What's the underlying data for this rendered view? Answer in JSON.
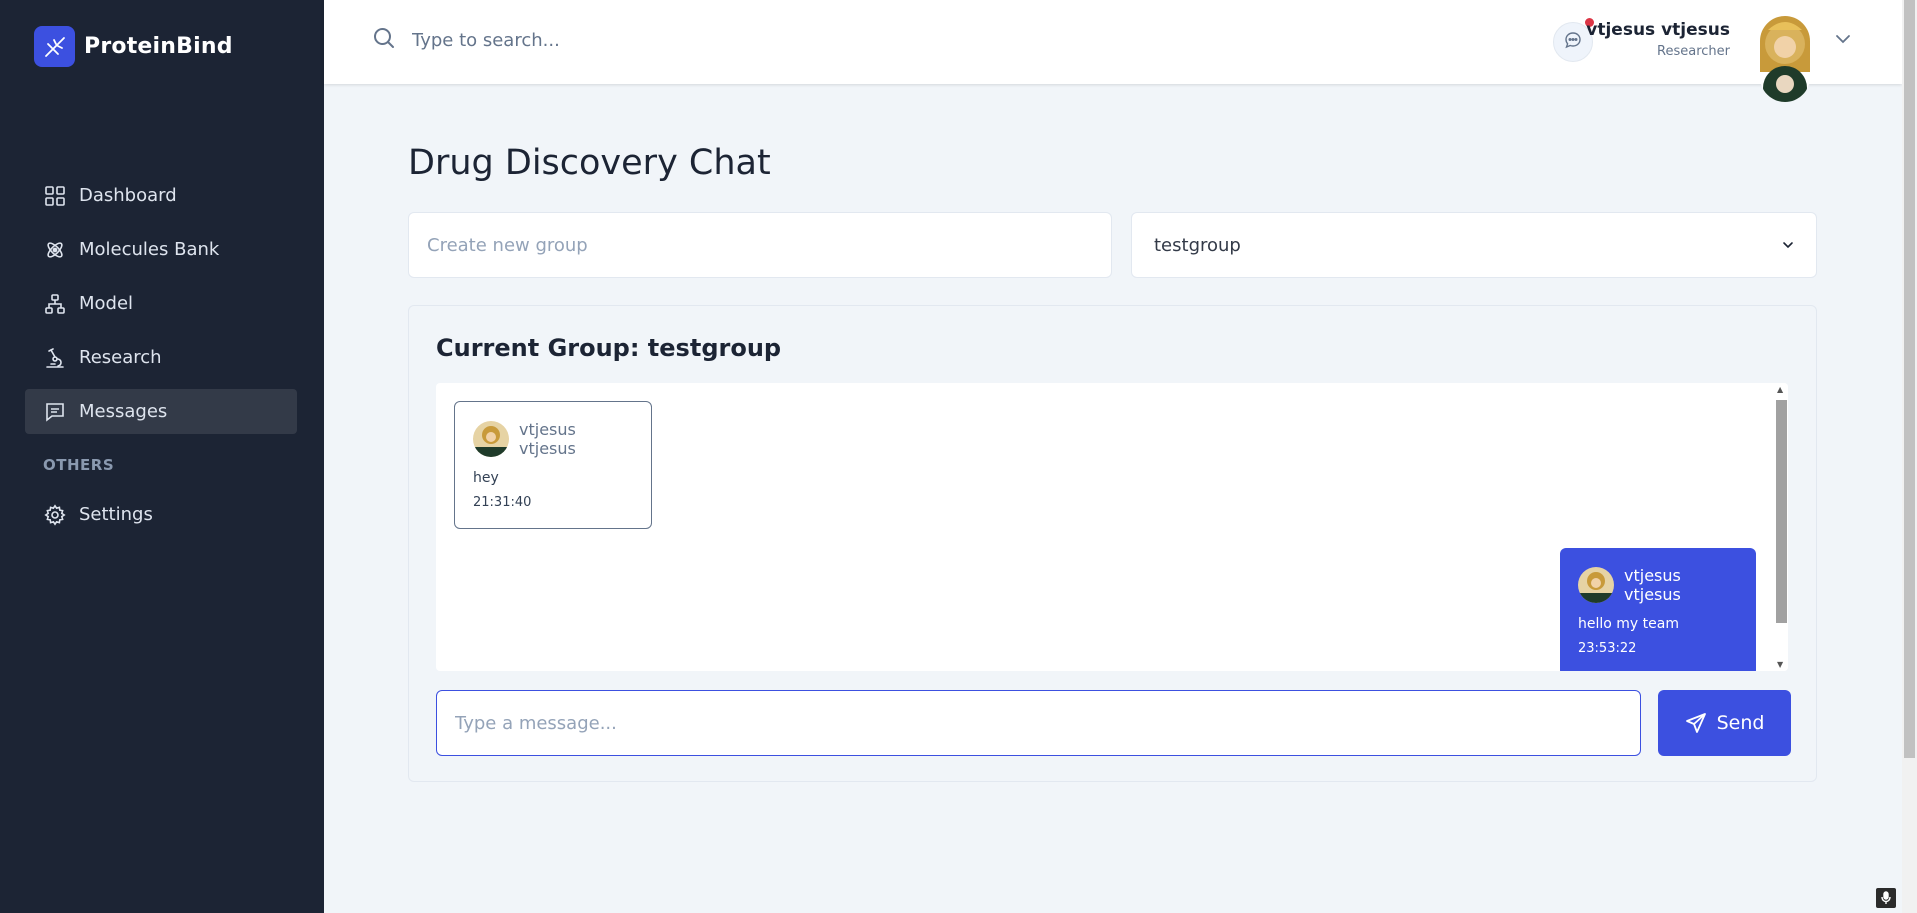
{
  "brand": {
    "name": "ProteinBind",
    "logo_icon": "dna-icon",
    "color": "#3c50e0"
  },
  "sidebar": {
    "items": [
      {
        "label": "Dashboard",
        "icon": "grid-icon",
        "active": false
      },
      {
        "label": "Molecules Bank",
        "icon": "atom-icon",
        "active": false
      },
      {
        "label": "Model",
        "icon": "hierarchy-icon",
        "active": false
      },
      {
        "label": "Research",
        "icon": "microscope-icon",
        "active": false
      },
      {
        "label": "Messages",
        "icon": "message-icon",
        "active": true
      }
    ],
    "section_label": "OTHERS",
    "other_items": [
      {
        "label": "Settings",
        "icon": "gear-icon",
        "active": false
      }
    ]
  },
  "header": {
    "search_placeholder": "Type to search...",
    "user_name": "vtjesus vtjesus",
    "user_role": "Researcher",
    "notification_dot_color": "#dc3545"
  },
  "main": {
    "title": "Drug Discovery Chat",
    "new_group_placeholder": "Create new group",
    "selected_group": "testgroup",
    "current_group_label": "Current Group: testgroup",
    "messages": [
      {
        "sender": "vtjesus vtjesus",
        "text": "hey",
        "time": "21:31:40",
        "own": false
      },
      {
        "sender": "vtjesus vtjesus",
        "text": "hello my team",
        "time": "23:53:22",
        "own": true
      }
    ],
    "message_placeholder": "Type a message...",
    "send_label": "Send"
  }
}
